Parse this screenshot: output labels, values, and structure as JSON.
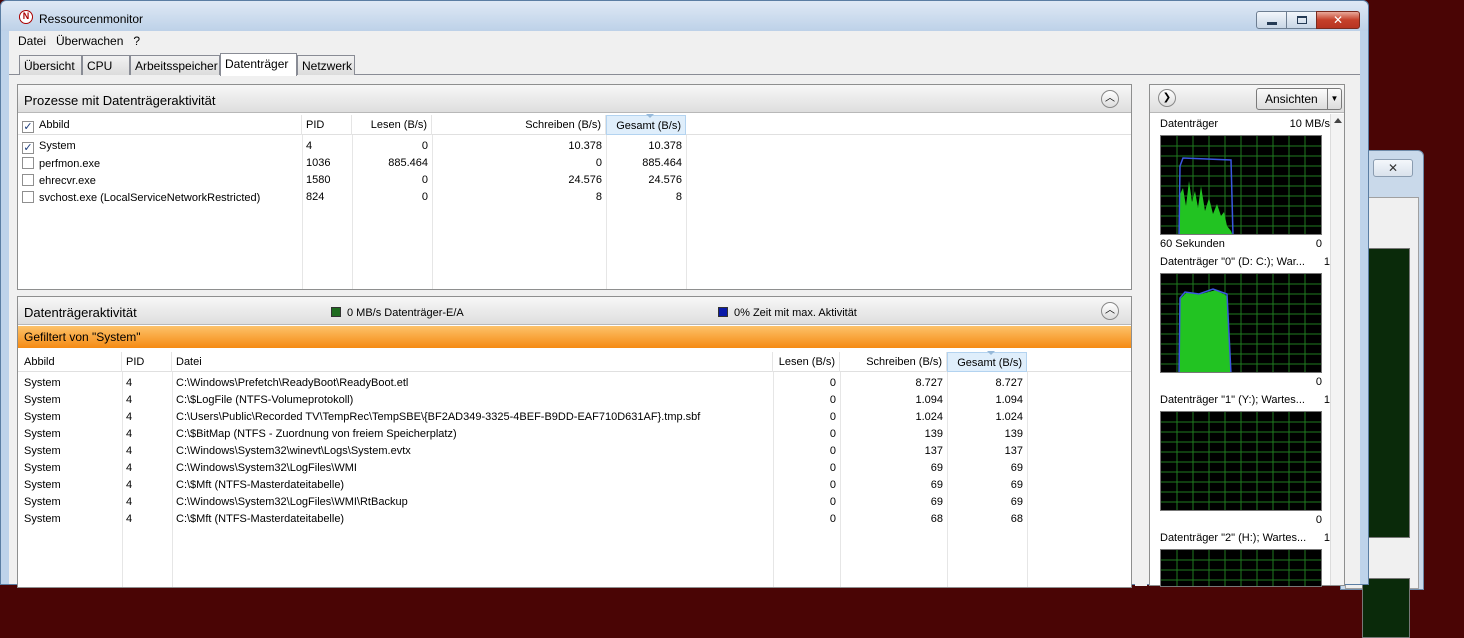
{
  "window": {
    "title": "Ressourcenmonitor"
  },
  "menu": [
    "Datei",
    "Überwachen",
    "?"
  ],
  "tabs": [
    "Übersicht",
    "CPU",
    "Arbeitsspeicher",
    "Datenträger",
    "Netzwerk"
  ],
  "active_tab": "Datenträger",
  "processes_panel": {
    "title": "Prozesse mit Datenträgeraktivität",
    "columns": [
      "Abbild",
      "PID",
      "Lesen (B/s)",
      "Schreiben (B/s)",
      "Gesamt (B/s)"
    ],
    "rows": [
      {
        "checked": true,
        "image": "System",
        "pid": "4",
        "read": "0",
        "write": "10.378",
        "total": "10.378"
      },
      {
        "checked": false,
        "image": "perfmon.exe",
        "pid": "1036",
        "read": "885.464",
        "write": "0",
        "total": "885.464"
      },
      {
        "checked": false,
        "image": "ehrecvr.exe",
        "pid": "1580",
        "read": "0",
        "write": "24.576",
        "total": "24.576"
      },
      {
        "checked": false,
        "image": "svchost.exe (LocalServiceNetworkRestricted)",
        "pid": "824",
        "read": "0",
        "write": "8",
        "total": "8"
      }
    ]
  },
  "disk_activity_panel": {
    "title": "Datenträgeraktivität",
    "legend_io": "0 MB/s Datenträger-E/A",
    "legend_io_color": "#1f6b1f",
    "legend_active": "0% Zeit mit max. Aktivität",
    "legend_active_color": "#0a1aa8",
    "filter": "Gefiltert von \"System\"",
    "columns": [
      "Abbild",
      "PID",
      "Datei",
      "Lesen (B/s)",
      "Schreiben (B/s)",
      "Gesamt (B/s)"
    ],
    "rows": [
      {
        "image": "System",
        "pid": "4",
        "file": "C:\\Windows\\Prefetch\\ReadyBoot\\ReadyBoot.etl",
        "read": "0",
        "write": "8.727",
        "total": "8.727"
      },
      {
        "image": "System",
        "pid": "4",
        "file": "C:\\$LogFile (NTFS-Volumeprotokoll)",
        "read": "0",
        "write": "1.094",
        "total": "1.094"
      },
      {
        "image": "System",
        "pid": "4",
        "file": "C:\\Users\\Public\\Recorded TV\\TempRec\\TempSBE\\{BF2AD349-3325-4BEF-B9DD-EAF710D631AF}.tmp.sbf",
        "read": "0",
        "write": "1.024",
        "total": "1.024"
      },
      {
        "image": "System",
        "pid": "4",
        "file": "C:\\$BitMap (NTFS - Zuordnung von freiem Speicherplatz)",
        "read": "0",
        "write": "139",
        "total": "139"
      },
      {
        "image": "System",
        "pid": "4",
        "file": "C:\\Windows\\System32\\winevt\\Logs\\System.evtx",
        "read": "0",
        "write": "137",
        "total": "137"
      },
      {
        "image": "System",
        "pid": "4",
        "file": "C:\\Windows\\System32\\LogFiles\\WMI",
        "read": "0",
        "write": "69",
        "total": "69"
      },
      {
        "image": "System",
        "pid": "4",
        "file": "C:\\$Mft (NTFS-Masterdateitabelle)",
        "read": "0",
        "write": "69",
        "total": "69"
      },
      {
        "image": "System",
        "pid": "4",
        "file": "C:\\Windows\\System32\\LogFiles\\WMI\\RtBackup",
        "read": "0",
        "write": "69",
        "total": "69"
      },
      {
        "image": "System",
        "pid": "4",
        "file": "C:\\$Mft (NTFS-Masterdateitabelle)",
        "read": "0",
        "write": "68",
        "total": "68"
      }
    ]
  },
  "side_pane": {
    "views_label": "Ansichten",
    "graphs": [
      {
        "label": "Datenträger",
        "scale": "10 MB/s",
        "foot_left": "60 Sekunden",
        "foot_right": "0"
      },
      {
        "label": "Datenträger \"0\" (D: C:); War...",
        "scale": "1",
        "foot_left": "",
        "foot_right": "0"
      },
      {
        "label": "Datenträger \"1\" (Y:); Wartes...",
        "scale": "1",
        "foot_left": "",
        "foot_right": "0"
      },
      {
        "label": "Datenträger \"2\" (H:); Wartes...",
        "scale": "1",
        "foot_left": "",
        "foot_right": ""
      }
    ],
    "graph_grid_color": "#1f7a1f",
    "activity_color": "#3a57e0",
    "io_fill_color": "#22c322"
  }
}
